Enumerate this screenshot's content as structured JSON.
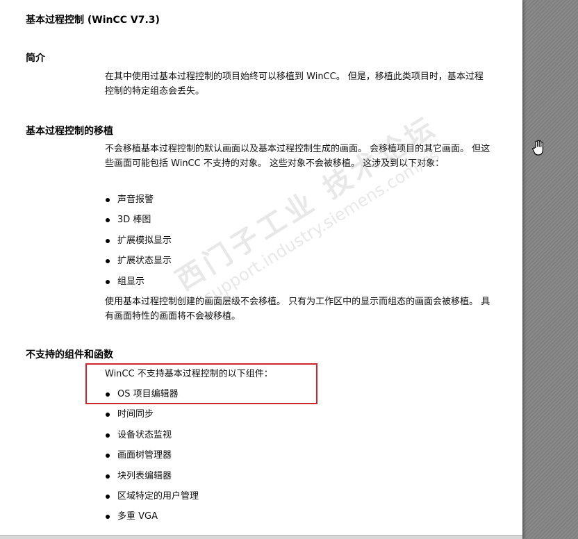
{
  "document": {
    "title": "基本过程控制 (WinCC V7.3)",
    "sections": [
      {
        "heading": "简介",
        "paragraphs": [
          "在其中使用过基本过程控制的项目始终可以移植到 WinCC。 但是，移植此类项目时，基本过程控制的特定组态会丢失。"
        ]
      },
      {
        "heading": "基本过程控制的移植",
        "paragraphs": [
          "不会移植基本过程控制的默认画面以及基本过程控制生成的画面。 会移植项目的其它画面。 但这些画面可能包括 WinCC 不支持的对象。 这些对象不会被移植。 这涉及到以下对象：",
          "使用基本过程控制创建的画面层级不会移植。 只有为工作区中的显示而组态的画面会被移植。 具有画面特性的画面将不会被移植。"
        ],
        "items": [
          "声音报警",
          "3D 棒图",
          "扩展模拟显示",
          "扩展状态显示",
          "组显示"
        ]
      },
      {
        "heading": "不支持的组件和函数",
        "paragraphs": [
          "WinCC 不支持基本过程控制的以下组件："
        ],
        "items": [
          "OS 项目编辑器",
          "时间同步",
          "设备状态监视",
          "画面树管理器",
          "块列表编辑器",
          "区域特定的用户管理",
          "多重 VGA"
        ]
      }
    ]
  },
  "watermark": {
    "line1": "西门子工业 技术论坛",
    "line2": "support.industry.siemens.com/cs"
  },
  "colors": {
    "highlight": "#d0232a",
    "page": "#ffffff",
    "background": "#858585"
  },
  "icons": {
    "cursor": "hand-cursor-icon"
  }
}
